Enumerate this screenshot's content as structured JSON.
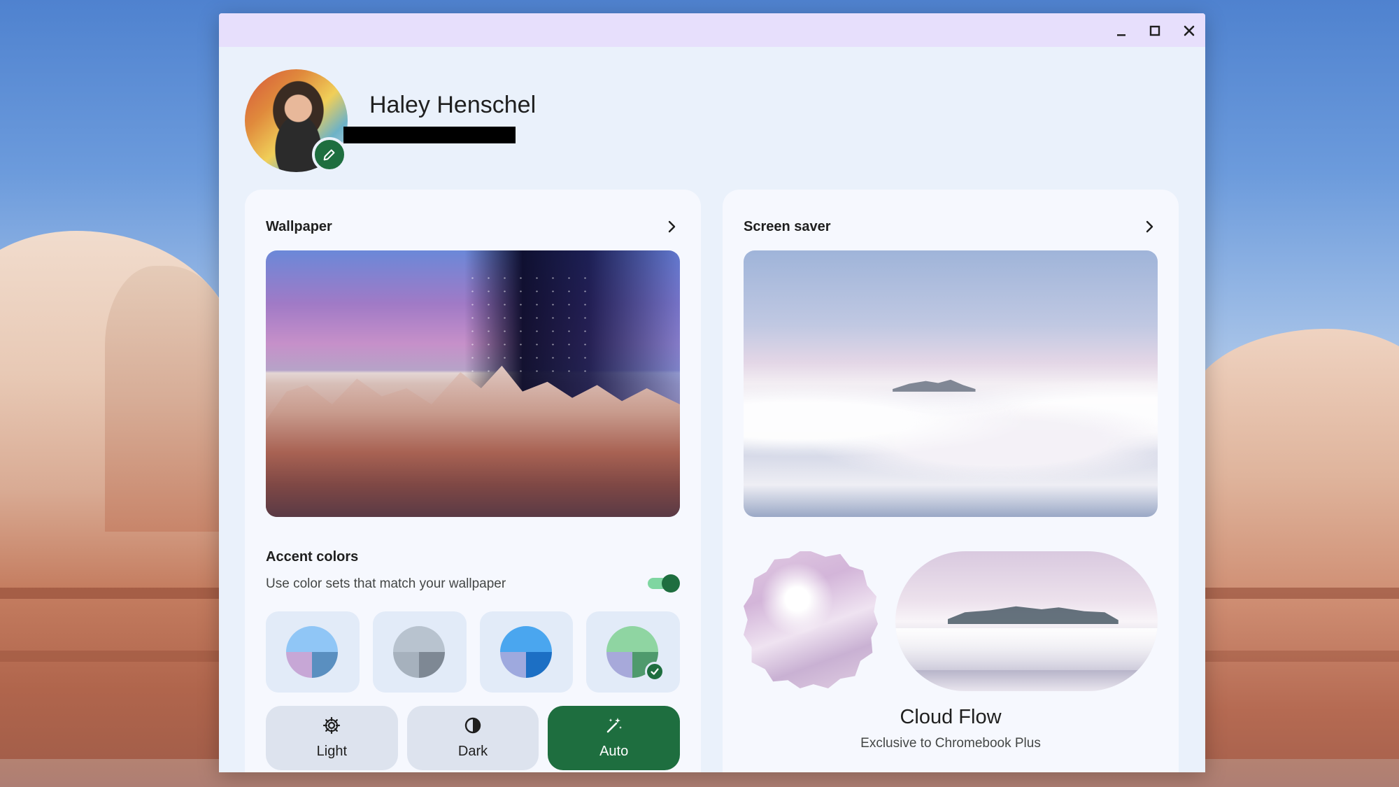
{
  "window": {
    "controls": {
      "minimize": "minimize-icon",
      "maximize": "maximize-icon",
      "close": "close-icon"
    }
  },
  "profile": {
    "name": "Haley Henschel",
    "edit_icon": "pencil-icon"
  },
  "wallpaper": {
    "title": "Wallpaper",
    "icon": "chevron-right-icon"
  },
  "accent": {
    "title": "Accent colors",
    "description": "Use color sets that match your wallpaper",
    "toggle_on": true,
    "swatches": [
      {
        "top": "#90c6f6",
        "bl": "#c7a7d6",
        "br": "#5a8fc0",
        "selected": false
      },
      {
        "top": "#b8c3cf",
        "bl": "#a6b1bd",
        "br": "#7e8894",
        "selected": false
      },
      {
        "top": "#4aa6ef",
        "bl": "#9ea9de",
        "br": "#1c6fc4",
        "selected": false
      },
      {
        "top": "#8fd5a2",
        "bl": "#a7a9da",
        "br": "#4f9a6d",
        "selected": true
      }
    ]
  },
  "modes": {
    "light": "Light",
    "dark": "Dark",
    "auto": "Auto",
    "active": "Auto"
  },
  "screensaver": {
    "title": "Screen saver",
    "icon": "chevron-right-icon",
    "name": "Cloud Flow",
    "subtitle": "Exclusive to Chromebook Plus"
  },
  "colors": {
    "accent_green": "#1e6e3f",
    "titlebar": "#e7dffc",
    "window_bg": "#eaf1fb"
  }
}
